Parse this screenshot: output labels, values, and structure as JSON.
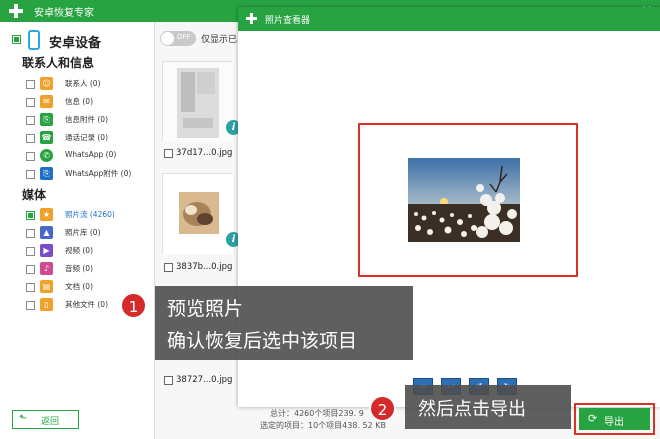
{
  "window": {
    "title": "安卓恢复专家",
    "minimize_glyph": "—",
    "close_glyph": "✕"
  },
  "sidebar": {
    "device_label": "安卓设备",
    "section_contacts": "联系人和信息",
    "contacts_items": [
      {
        "label": "联系人 (0)",
        "icon": "contact-icon",
        "color": "#f0a12b"
      },
      {
        "label": "信息 (0)",
        "icon": "message-icon",
        "color": "#f0a12b"
      },
      {
        "label": "信息附件 (0)",
        "icon": "attachment-icon",
        "color": "#27a342"
      },
      {
        "label": "通话记录 (0)",
        "icon": "phone-icon",
        "color": "#27a342"
      },
      {
        "label": "WhatsApp (0)",
        "icon": "whatsapp-icon",
        "color": "#27a342"
      },
      {
        "label": "WhatsApp附件 (0)",
        "icon": "whatsapp-attachment-icon",
        "color": "#1f6fc5"
      }
    ],
    "section_media": "媒体",
    "media_items": [
      {
        "label": "照片流 (4260)",
        "icon": "star-icon",
        "color": "#f0a12b",
        "active": true
      },
      {
        "label": "照片库 (0)",
        "icon": "gallery-icon",
        "color": "#4a66c8"
      },
      {
        "label": "视频 (0)",
        "icon": "video-icon",
        "color": "#7a4cc8"
      },
      {
        "label": "音频 (0)",
        "icon": "audio-icon",
        "color": "#d04a8f"
      },
      {
        "label": "文档 (0)",
        "icon": "document-icon",
        "color": "#f0a12b"
      },
      {
        "label": "其他文件 (0)",
        "icon": "file-icon",
        "color": "#f0a12b"
      }
    ],
    "back_label": "返回"
  },
  "main": {
    "toggle_state": "OFF",
    "toggle_label": "仅显示已",
    "files": [
      {
        "name": "37d17...0.jpg"
      },
      {
        "name": "3837b...0.jpg"
      },
      {
        "name": "38727...0.jpg"
      }
    ],
    "status_total": "总计：4260个项目239. 9",
    "status_selected": "选定的项目：10个项目438. 52 KB"
  },
  "viewer": {
    "title": "照片查看器",
    "tools": [
      {
        "icon": "previous-icon",
        "glyph": "⏮"
      },
      {
        "icon": "next-icon",
        "glyph": "⏭"
      },
      {
        "icon": "rotate-left-icon",
        "glyph": "↺"
      },
      {
        "icon": "rotate-right-icon",
        "glyph": "↻"
      }
    ]
  },
  "callouts": [
    {
      "number": "1",
      "line1": "预览照片",
      "line2": "确认恢复后选中该项目"
    },
    {
      "number": "2",
      "line1": "然后点击导出"
    }
  ],
  "export": {
    "label": "导出",
    "icon": "export-icon"
  },
  "colors": {
    "accent": "#27a342",
    "highlight": "#d9302c",
    "callout_bg": "#4e4e4e",
    "badge": "#d42a2a"
  }
}
